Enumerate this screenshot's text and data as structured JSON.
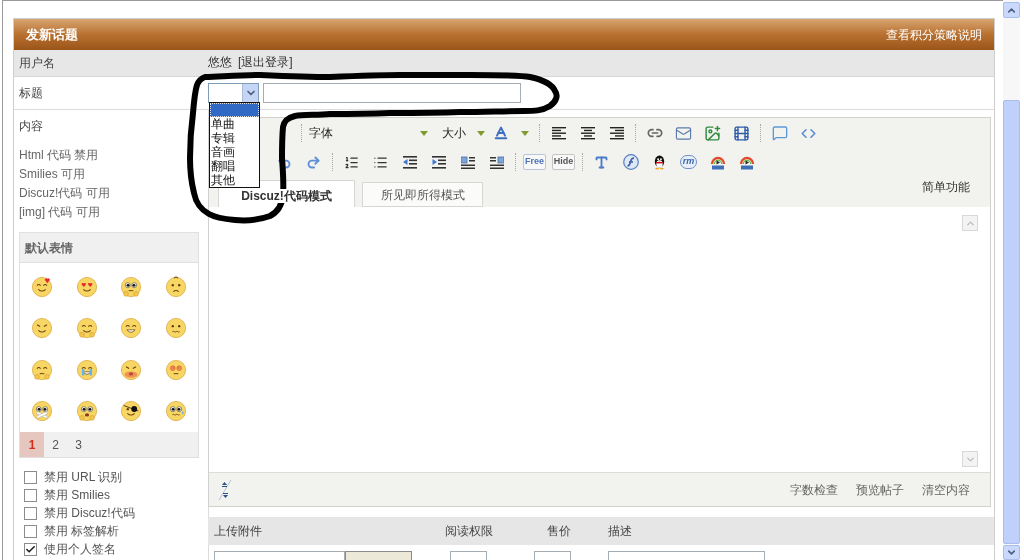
{
  "panel": {
    "title": "发新话题",
    "credits_link": "查看积分策略说明"
  },
  "username_row": {
    "label": "用户名",
    "name": "悠悠",
    "logout_link": "[退出登录]"
  },
  "subject_row": {
    "label": "标题",
    "type_select": {
      "expanded": true,
      "options": [
        {
          "selected": true
        },
        {
          "label": "单曲",
          "selected": false
        },
        {
          "label": "专辑",
          "selected": false
        },
        {
          "label": "音画",
          "selected": false
        },
        {
          "label": "翻唱",
          "selected": false
        },
        {
          "label": "其他",
          "selected": false
        }
      ]
    }
  },
  "content_row": {
    "label": "内容",
    "code_status": [
      "Html 代码 禁用",
      "Smilies 可用",
      "Discuz!代码 可用",
      "[img] 代码 可用"
    ]
  },
  "smilies": {
    "title": "默认表情",
    "pages": [
      {
        "label": "1",
        "selected": true
      },
      {
        "label": "2",
        "selected": false
      },
      {
        "label": "3",
        "selected": false
      }
    ]
  },
  "post_options": [
    {
      "label": "禁用 URL 识别",
      "checked": false
    },
    {
      "label": "禁用 Smilies",
      "checked": false
    },
    {
      "label": "禁用 Discuz!代码",
      "checked": false
    },
    {
      "label": "禁用 标签解析",
      "checked": false
    },
    {
      "label": "使用个人签名",
      "checked": true
    }
  ],
  "editor": {
    "toolbar": {
      "font_menu": "字体",
      "size_menu": "大小",
      "free_tag": "Free",
      "hide_tag": "Hide",
      "rm_media": "rm"
    },
    "tabs": [
      {
        "label": "Discuz!代码模式",
        "selected": true
      },
      {
        "label": "所见即所得模式",
        "selected": false
      }
    ],
    "simple_mode": "简单功能",
    "footer_actions": [
      "字数检查",
      "预览帖子",
      "清空内容"
    ]
  },
  "attachments": {
    "columns": [
      "上传附件",
      "阅读权限",
      "售价",
      "描述"
    ]
  }
}
